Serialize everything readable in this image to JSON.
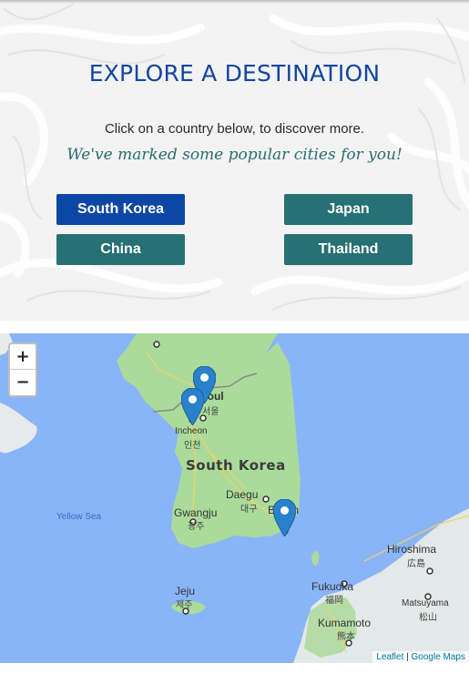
{
  "header": {
    "title": "EXPLORE A DESTINATION",
    "intro": "Click on a country below, to discover more.",
    "tagline": "We've marked some popular cities for you!"
  },
  "countries": [
    {
      "label": "South Korea",
      "active": true
    },
    {
      "label": "Japan",
      "active": false
    },
    {
      "label": "China",
      "active": false
    },
    {
      "label": "Thailand",
      "active": false
    }
  ],
  "colors": {
    "title": "#1346a0",
    "active_button": "#0d47a6",
    "button": "#277074",
    "tagline": "#2a6d71",
    "water": "#8ab4f8",
    "land": "#aadb9b",
    "marker": "#2a81cb"
  },
  "map": {
    "zoom_in": "+",
    "zoom_out": "−",
    "country_label": "South Korea",
    "water_label": "Yellow Sea",
    "cities": [
      {
        "name": "Seoul",
        "native": "서울"
      },
      {
        "name": "Incheon",
        "native": "인천"
      },
      {
        "name": "Daegu",
        "native": "대구"
      },
      {
        "name": "Gwangju",
        "native": "광주"
      },
      {
        "name": "Busan",
        "native": "부산"
      },
      {
        "name": "Jeju",
        "native": "제주"
      },
      {
        "name": "Hiroshima",
        "native": "広島"
      },
      {
        "name": "Fukuoka",
        "native": "福岡"
      },
      {
        "name": "Matsuyama",
        "native": "松山"
      },
      {
        "name": "Kumamoto",
        "native": "熊本"
      }
    ],
    "markers": [
      "marker-seoul",
      "marker-incheon",
      "marker-busan"
    ],
    "attribution": {
      "leaflet": "Leaflet",
      "separator": " | ",
      "provider": "Google Maps"
    }
  }
}
